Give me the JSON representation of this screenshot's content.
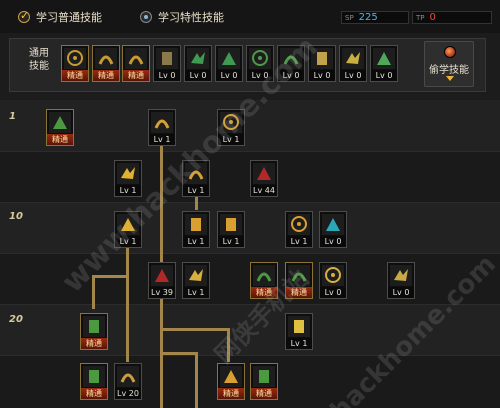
{
  "tabs": [
    {
      "label": "学习普通技能",
      "active": true
    },
    {
      "label": "学习特性技能",
      "active": false
    }
  ],
  "sp": {
    "sp_label": "SP",
    "sp_value": "225",
    "tp_label": "TP",
    "tp_value": "0"
  },
  "general": {
    "label_line1": "通用",
    "label_line2": "技能",
    "skills": [
      {
        "name": "squat-icon",
        "caption": "精通",
        "master": true,
        "color": "#c89a32"
      },
      {
        "name": "jump-icon",
        "caption": "精通",
        "master": true,
        "color": "#c89a32"
      },
      {
        "name": "fight-icon",
        "caption": "精通",
        "master": true,
        "color": "#c89a32"
      },
      {
        "name": "wing-icon",
        "caption": "Lv 0",
        "master": false,
        "color": "#8a7a4a"
      },
      {
        "name": "crosshair-icon",
        "caption": "Lv 0",
        "master": false,
        "color": "#3f9a52"
      },
      {
        "name": "crosshair-alt-icon",
        "caption": "Lv 0",
        "master": false,
        "color": "#3f9a52"
      },
      {
        "name": "figure-icon",
        "caption": "Lv 0",
        "master": false,
        "color": "#4f9a4a"
      },
      {
        "name": "figure-alt-icon",
        "caption": "Lv 0",
        "master": false,
        "color": "#4f9a4a"
      },
      {
        "name": "eye-icon",
        "caption": "Lv 0",
        "master": false,
        "color": "#c4a24a"
      },
      {
        "name": "muscle-icon",
        "caption": "Lv 0",
        "master": false,
        "color": "#c8b040"
      },
      {
        "name": "leaf-icon",
        "caption": "Lv 0",
        "master": false,
        "color": "#4fa85a"
      }
    ]
  },
  "steal_button": {
    "label": "偷学技能"
  },
  "level_labels": [
    "1",
    "10",
    "20"
  ],
  "tree_skills": [
    {
      "name": "rune-icon",
      "caption": "精通",
      "master": true,
      "color": "#4c9a40"
    },
    {
      "name": "hook-icon",
      "caption": "Lv 1",
      "master": false,
      "color": "#d8a030"
    },
    {
      "name": "kick-icon",
      "caption": "Lv 1",
      "master": false,
      "color": "#d8a030"
    },
    {
      "name": "burst-icon",
      "caption": "Lv 1",
      "master": false,
      "color": "#e0b030"
    },
    {
      "name": "dash-icon",
      "caption": "Lv 1",
      "master": false,
      "color": "#d8a030"
    },
    {
      "name": "red-lock-icon",
      "caption": "Lv 44",
      "master": false,
      "color": "#b02828"
    },
    {
      "name": "slash-icon",
      "caption": "Lv 1",
      "master": false,
      "color": "#e0b030"
    },
    {
      "name": "sprint-icon",
      "caption": "Lv 1",
      "master": false,
      "color": "#d8a030"
    },
    {
      "name": "blade-icon",
      "caption": "Lv 1",
      "master": false,
      "color": "#d8a030"
    },
    {
      "name": "uppercut-icon",
      "caption": "Lv 1",
      "master": false,
      "color": "#d8a030"
    },
    {
      "name": "cyan-trident-icon",
      "caption": "Lv 0",
      "master": false,
      "color": "#2aa8b8"
    },
    {
      "name": "red-figure-icon",
      "caption": "Lv 39",
      "master": false,
      "color": "#b02828"
    },
    {
      "name": "flag-icon",
      "caption": "Lv 1",
      "master": false,
      "color": "#d8b040"
    },
    {
      "name": "green-figure-icon",
      "caption": "精通",
      "master": true,
      "color": "#4c9a40"
    },
    {
      "name": "green-slash-icon",
      "caption": "精通",
      "master": true,
      "color": "#4c9a40"
    },
    {
      "name": "wave-icon",
      "caption": "Lv 0",
      "master": false,
      "color": "#d8b040"
    },
    {
      "name": "grenade-icon",
      "caption": "Lv 0",
      "master": false,
      "color": "#c8a848"
    },
    {
      "name": "green-wave-icon",
      "caption": "精通",
      "master": true,
      "color": "#4c9a40"
    },
    {
      "name": "shield-icon",
      "caption": "Lv 1",
      "master": false,
      "color": "#e0c040"
    },
    {
      "name": "green-dragon-icon",
      "caption": "精通",
      "master": true,
      "color": "#4c9a40"
    },
    {
      "name": "claw-icon",
      "caption": "Lv 20",
      "master": false,
      "color": "#c8a040"
    },
    {
      "name": "punch-icon",
      "caption": "精通",
      "master": true,
      "color": "#d8a030"
    },
    {
      "name": "green-spear-icon",
      "caption": "精通",
      "master": true,
      "color": "#4c9a40"
    }
  ],
  "watermarks": [
    "www.hackhome.com",
    "网侠手机站",
    "hackhome.com"
  ]
}
